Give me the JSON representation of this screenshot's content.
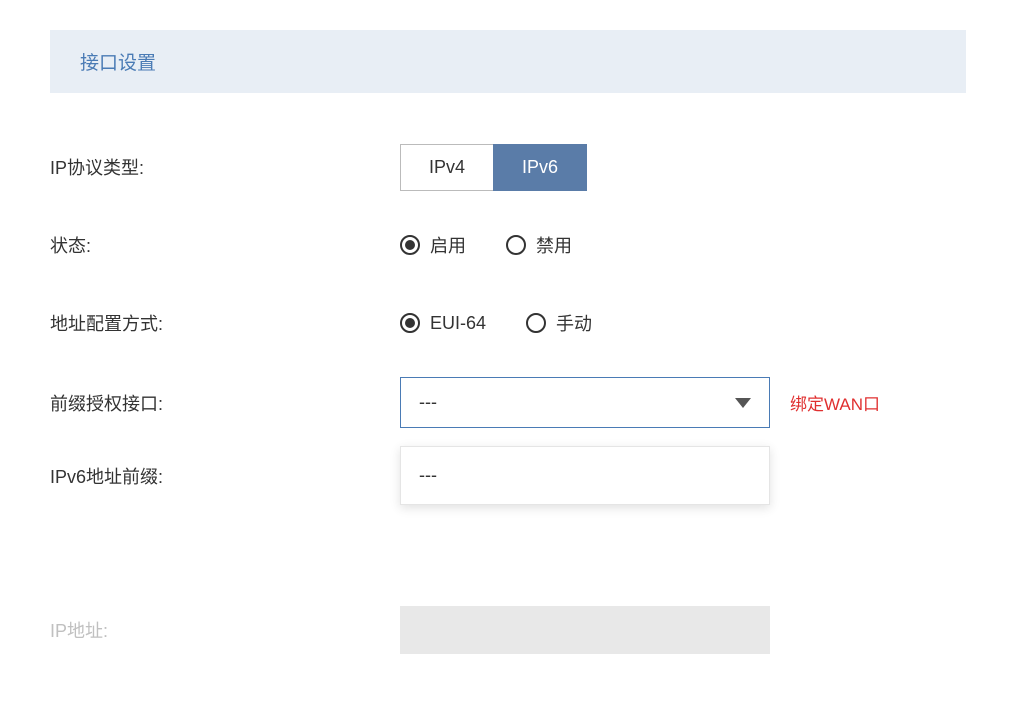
{
  "section": {
    "title": "接口设置"
  },
  "form": {
    "ipProtocol": {
      "label": "IP协议类型:",
      "options": {
        "ipv4": "IPv4",
        "ipv6": "IPv6"
      },
      "selected": "ipv6"
    },
    "status": {
      "label": "状态:",
      "options": {
        "enable": "启用",
        "disable": "禁用"
      },
      "selected": "enable"
    },
    "addressConfig": {
      "label": "地址配置方式:",
      "options": {
        "eui64": "EUI-64",
        "manual": "手动"
      },
      "selected": "eui64"
    },
    "prefixInterface": {
      "label": "前缀授权接口:",
      "value": "---",
      "hint": "绑定WAN口",
      "dropdownOptions": [
        "---"
      ]
    },
    "ipv6Prefix": {
      "label": "IPv6地址前缀:",
      "value": "---"
    },
    "ipAddress": {
      "label": "IP地址:"
    }
  }
}
